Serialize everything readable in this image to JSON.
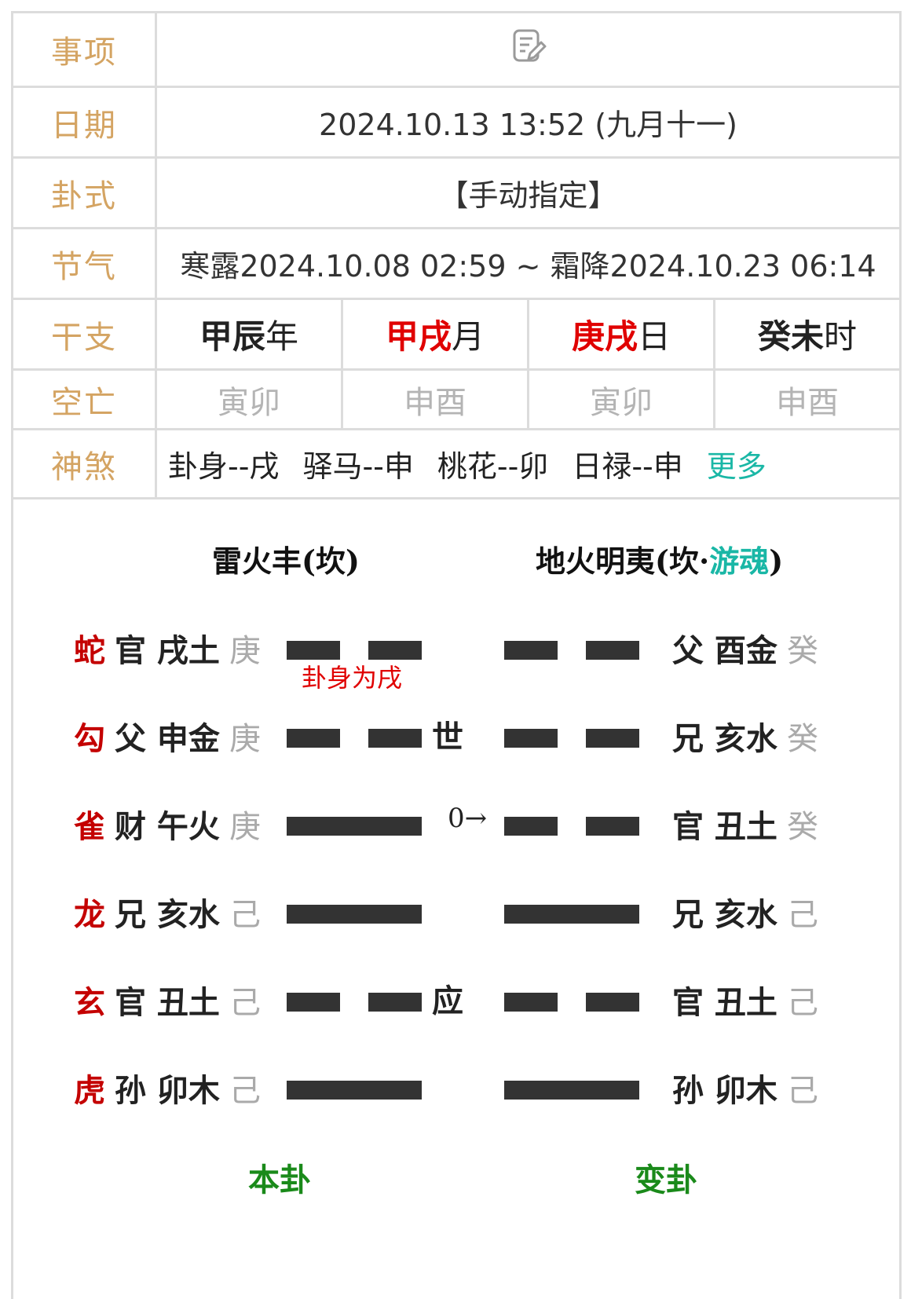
{
  "info": {
    "event_label": "事项",
    "date_label": "日期",
    "date_value": "2024.10.13 13:52 (九月十一)",
    "gua_label": "卦式",
    "gua_value": "【手动指定】",
    "term_label": "节气",
    "term_value": "寒露2024.10.08 02:59 ~ 霜降2024.10.23 06:14",
    "ganzhi_label": "干支",
    "ganzhi": [
      {
        "stem": "甲辰",
        "unit": "年",
        "highlight": false
      },
      {
        "stem": "甲戌",
        "unit": "月",
        "highlight": true
      },
      {
        "stem": "庚戌",
        "unit": "日",
        "highlight": true
      },
      {
        "stem": "癸未",
        "unit": "时",
        "highlight": false
      }
    ],
    "void_label": "空亡",
    "void": [
      "寅卯",
      "申酉",
      "寅卯",
      "申酉"
    ],
    "shensha_label": "神煞",
    "shensha": [
      "卦身--戌",
      "驿马--申",
      "桃花--卯",
      "日禄--申"
    ],
    "more_label": "更多"
  },
  "hexagram": {
    "main_title": "雷火丰(坎)",
    "changed_title_prefix": "地火明夷(坎·",
    "changed_title_soul": "游魂",
    "changed_title_suffix": ")",
    "note": "卦身为戌",
    "main_label": "本卦",
    "changed_label": "变卦",
    "lines": [
      {
        "beast": "蛇",
        "left": "官 戌土",
        "left_stem": "庚",
        "main": "yin",
        "mark": "",
        "moving": "",
        "changed": "yin",
        "right": "父 酉金",
        "right_stem": "癸"
      },
      {
        "beast": "勾",
        "left": "父 申金",
        "left_stem": "庚",
        "main": "yin",
        "mark": "世",
        "moving": "",
        "changed": "yin",
        "right": "兄 亥水",
        "right_stem": "癸"
      },
      {
        "beast": "雀",
        "left": "财 午火",
        "left_stem": "庚",
        "main": "yang",
        "mark": "",
        "moving": "0→",
        "changed": "yin",
        "right": "官 丑土",
        "right_stem": "癸"
      },
      {
        "beast": "龙",
        "left": "兄 亥水",
        "left_stem": "己",
        "main": "yang",
        "mark": "",
        "moving": "",
        "changed": "yang",
        "right": "兄 亥水",
        "right_stem": "己"
      },
      {
        "beast": "玄",
        "left": "官 丑土",
        "left_stem": "己",
        "main": "yin",
        "mark": "应",
        "moving": "",
        "changed": "yin",
        "right": "官 丑土",
        "right_stem": "己"
      },
      {
        "beast": "虎",
        "left": "孙 卯木",
        "left_stem": "己",
        "main": "yang",
        "mark": "",
        "moving": "",
        "changed": "yang",
        "right": "孙 卯木",
        "right_stem": "己"
      }
    ]
  }
}
